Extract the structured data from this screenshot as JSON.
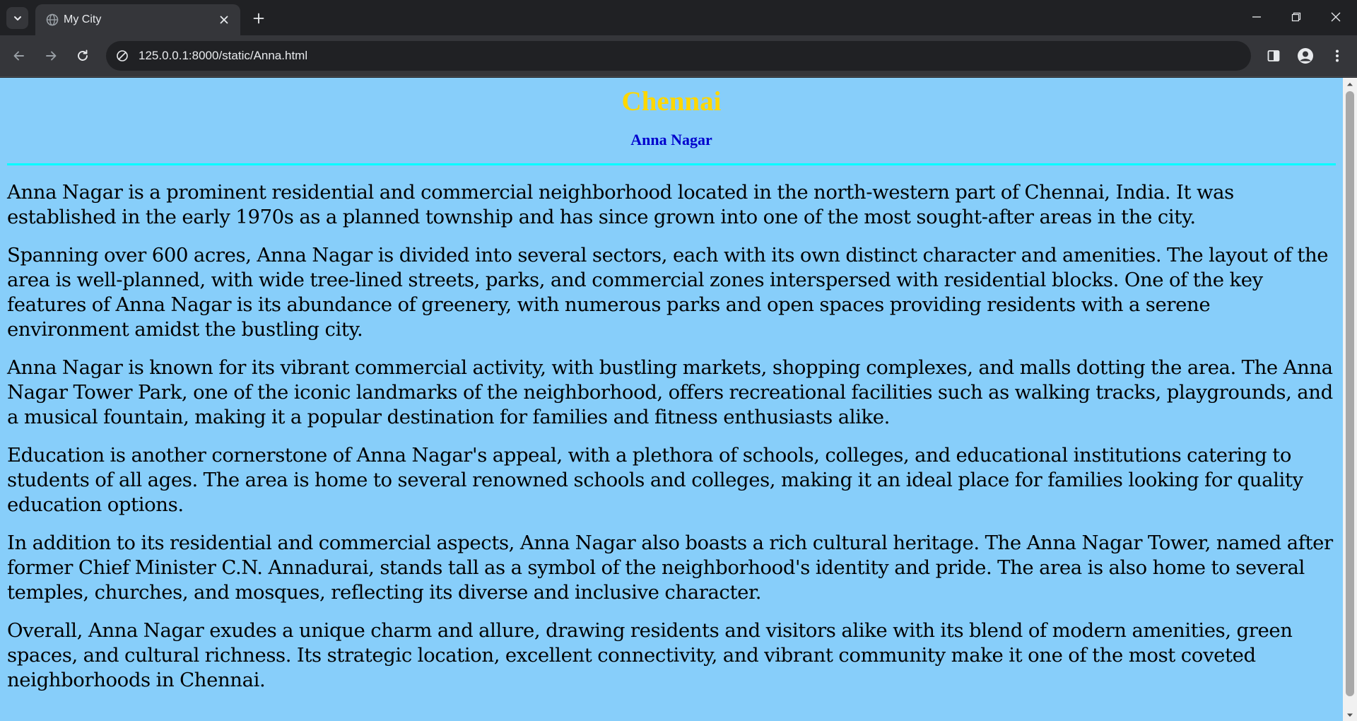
{
  "browser": {
    "tab_title": "My City",
    "url": "125.0.0.1:8000/static/Anna.html"
  },
  "page": {
    "city_title": "Chennai",
    "area_title": "Anna Nagar",
    "paragraphs": [
      "Anna Nagar is a prominent residential and commercial neighborhood located in the north-western part of Chennai, India. It was established in the early 1970s as a planned township and has since grown into one of the most sought-after areas in the city.",
      "Spanning over 600 acres, Anna Nagar is divided into several sectors, each with its own distinct character and amenities. The layout of the area is well-planned, with wide tree-lined streets, parks, and commercial zones interspersed with residential blocks. One of the key features of Anna Nagar is its abundance of greenery, with numerous parks and open spaces providing residents with a serene environment amidst the bustling city.",
      "Anna Nagar is known for its vibrant commercial activity, with bustling markets, shopping complexes, and malls dotting the area. The Anna Nagar Tower Park, one of the iconic landmarks of the neighborhood, offers recreational facilities such as walking tracks, playgrounds, and a musical fountain, making it a popular destination for families and fitness enthusiasts alike.",
      "Education is another cornerstone of Anna Nagar's appeal, with a plethora of schools, colleges, and educational institutions catering to students of all ages. The area is home to several renowned schools and colleges, making it an ideal place for families looking for quality education options.",
      "In addition to its residential and commercial aspects, Anna Nagar also boasts a rich cultural heritage. The Anna Nagar Tower, named after former Chief Minister C.N. Annadurai, stands tall as a symbol of the neighborhood's identity and pride. The area is also home to several temples, churches, and mosques, reflecting its diverse and inclusive character.",
      "Overall, Anna Nagar exudes a unique charm and allure, drawing residents and visitors alike with its blend of modern amenities, green spaces, and cultural richness. Its strategic location, excellent connectivity, and vibrant community make it one of the most coveted neighborhoods in Chennai."
    ]
  },
  "colors": {
    "page_background": "#87cefa",
    "city_title": "#ffd700",
    "area_title": "#0000cd",
    "divider": "#00ffff"
  },
  "icons": {
    "tab_search": "chevron-down-icon",
    "favicon": "globe-icon",
    "tab_close": "close-icon",
    "new_tab": "plus-icon",
    "back": "arrow-left-icon",
    "forward": "arrow-right-icon",
    "reload": "reload-icon",
    "site_info": "site-info-icon",
    "side_panel": "side-panel-icon",
    "profile": "profile-icon",
    "menu": "kebab-menu-icon"
  }
}
